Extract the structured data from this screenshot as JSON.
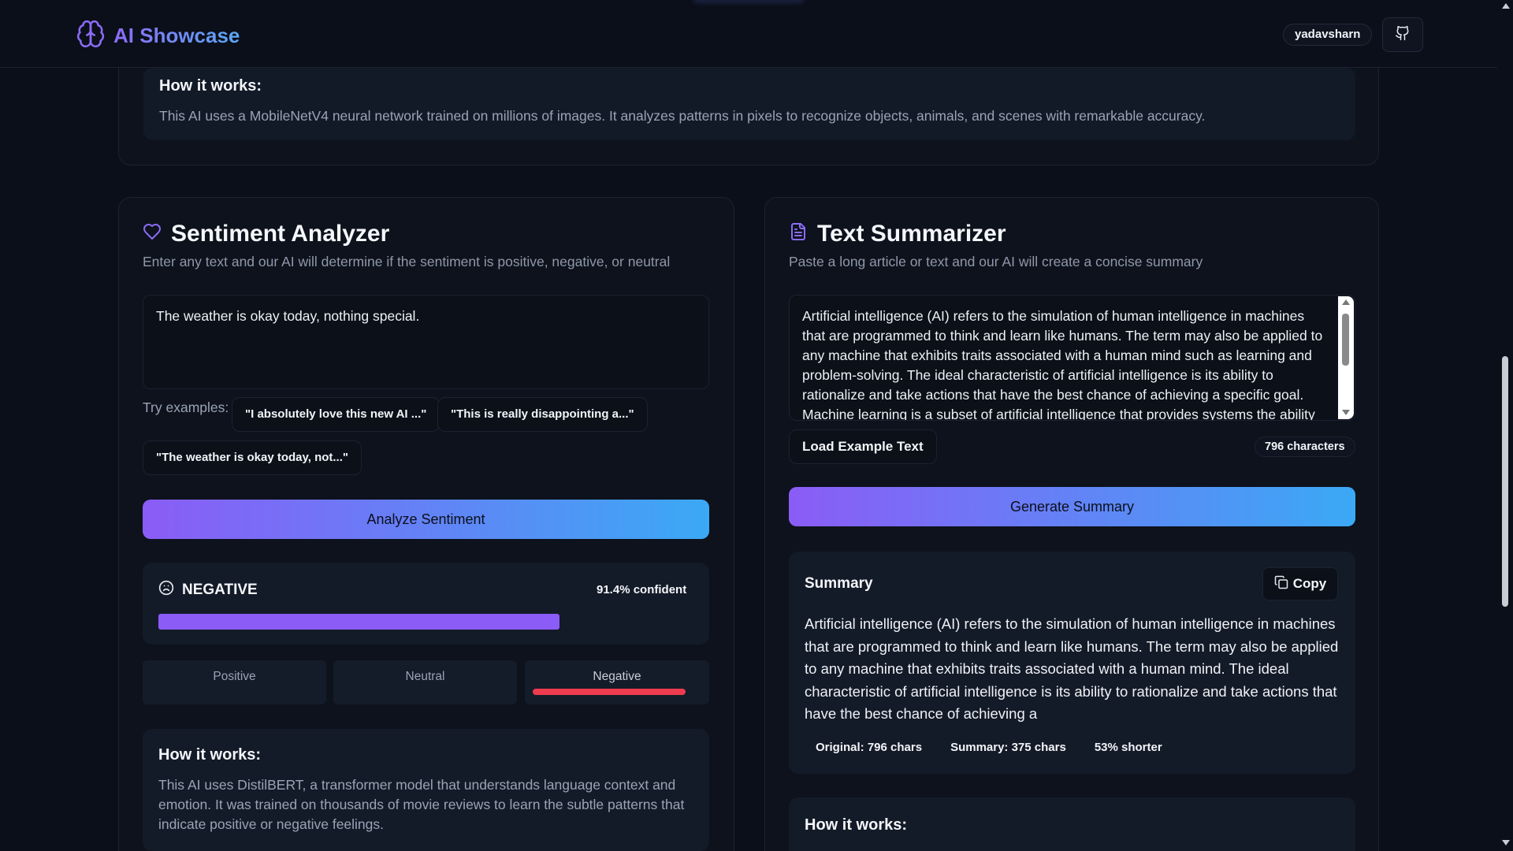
{
  "header": {
    "brand": "AI Showcase",
    "username": "yadavsharn"
  },
  "image_card": {
    "how_title": "How it works:",
    "how_text": "This AI uses a MobileNetV4 neural network trained on millions of images. It analyzes patterns in pixels to recognize objects, animals, and scenes with remarkable accuracy."
  },
  "sentiment": {
    "title": "Sentiment Analyzer",
    "subtitle": "Enter any text and our AI will determine if the sentiment is positive, negative, or neutral",
    "input_value": "The weather is okay today, nothing special.",
    "examples_label": "Try examples:",
    "examples": [
      "\"I absolutely love this new AI ...\"",
      "\"This is really disappointing a...\"",
      "\"The weather is okay today, not...\""
    ],
    "analyze_label": "Analyze Sentiment",
    "result_label": "NEGATIVE",
    "confidence_text": "91.4% confident",
    "confidence_value": 0.914,
    "segments": [
      "Positive",
      "Neutral",
      "Negative"
    ],
    "active_segment": "Negative",
    "how_title": "How it works:",
    "how_text": "This AI uses DistilBERT, a transformer model that understands language context and emotion. It was trained on thousands of movie reviews to learn the subtle patterns that indicate positive or negative feelings.",
    "colors": {
      "accent": "#8b5cf6",
      "negative": "#ef3b4f"
    }
  },
  "summarizer": {
    "title": "Text Summarizer",
    "subtitle": "Paste a long article or text and our AI will create a concise summary",
    "input_value": "Artificial intelligence (AI) refers to the simulation of human intelligence in machines that are programmed to think and learn like humans. The term may also be applied to any machine that exhibits traits associated with a human mind such as learning and problem-solving. The ideal characteristic of artificial intelligence is its ability to rationalize and take actions that have the best chance of achieving a specific goal. Machine learning is a subset of artificial intelligence that provides systems the ability",
    "load_example_label": "Load Example Text",
    "char_count": "796 characters",
    "generate_label": "Generate Summary",
    "summary_title": "Summary",
    "copy_label": "Copy",
    "summary_text": "Artificial intelligence (AI) refers to the simulation of human intelligence in machines that are programmed to think and learn like humans. The term may also be applied to any machine that exhibits traits associated with a human mind. The ideal characteristic of artificial intelligence is its ability to rationalize and take actions that have the best chance of achieving a",
    "stats": [
      "Original: 796 chars",
      "Summary: 375 chars",
      "53% shorter"
    ],
    "how_title": "How it works:"
  }
}
